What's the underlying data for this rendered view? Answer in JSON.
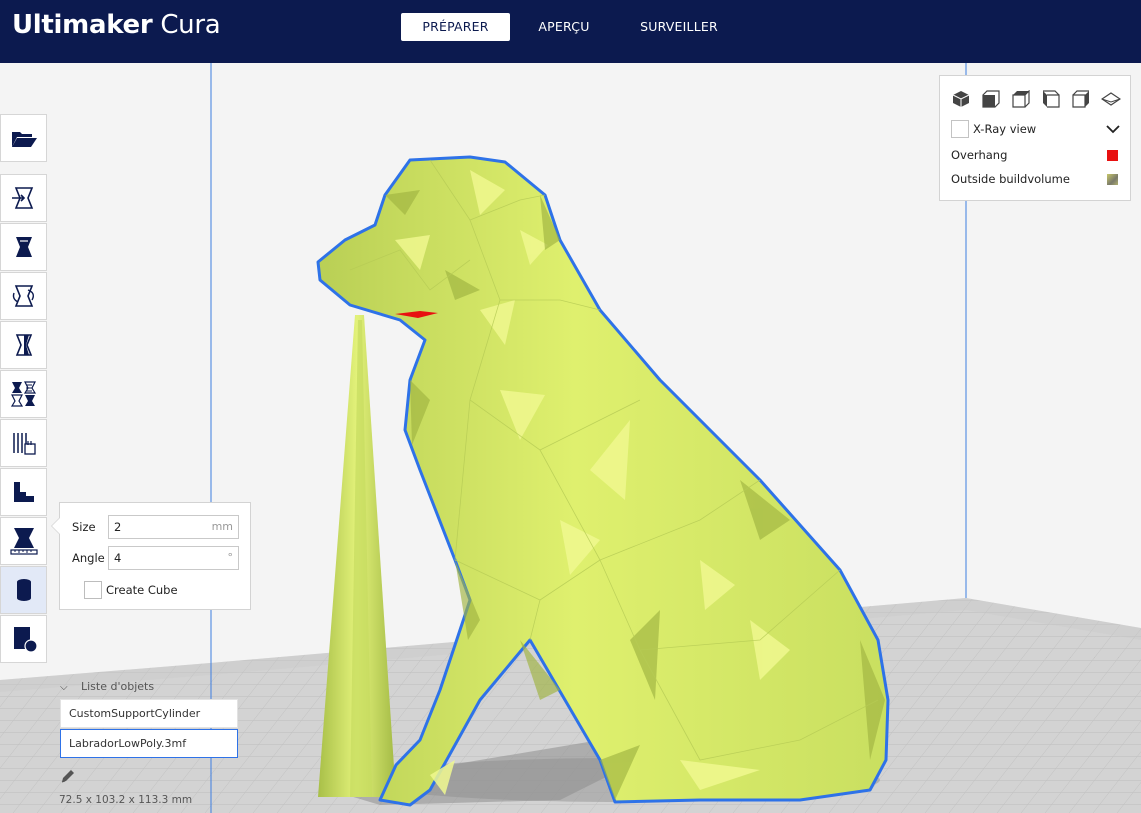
{
  "header": {
    "brand_bold": "Ultimaker",
    "brand_light": " Cura",
    "tabs": [
      {
        "label": "PRÉPARER",
        "active": true
      },
      {
        "label": "APERÇU",
        "active": false
      },
      {
        "label": "SURVEILLER",
        "active": false
      }
    ]
  },
  "toolbar": {
    "tools": [
      {
        "name": "open-file-icon"
      },
      {
        "name": "move-tool-icon"
      },
      {
        "name": "scale-tool-icon"
      },
      {
        "name": "rotate-tool-icon"
      },
      {
        "name": "mirror-tool-icon"
      },
      {
        "name": "per-model-settings-icon"
      },
      {
        "name": "support-blocker-icon"
      },
      {
        "name": "layer-step-icon"
      },
      {
        "name": "measure-icon"
      },
      {
        "name": "support-cylinder-icon",
        "active": true
      },
      {
        "name": "support-cube-icon"
      }
    ]
  },
  "support_panel": {
    "size_label": "Size",
    "size_value": "2",
    "size_unit": "mm",
    "angle_label": "Angle",
    "angle_value": "4",
    "angle_unit": "°",
    "create_cube_label": "Create Cube",
    "create_cube_checked": false
  },
  "view_panel": {
    "camera_icons": [
      "3d-view-icon",
      "front-view-icon",
      "top-view-icon",
      "left-view-icon",
      "right-view-icon",
      "perspective-toggle-icon"
    ],
    "xray_label": "X-Ray view",
    "xray_checked": false,
    "overhang_label": "Overhang",
    "overhang_color": "#e81010",
    "outside_label": "Outside buildvolume",
    "outside_color": "#9a9a6a"
  },
  "object_list": {
    "header": "Liste d'objets",
    "items": [
      {
        "label": "CustomSupportCylinder",
        "selected": false
      },
      {
        "label": "LabradorLowPoly.3mf",
        "selected": true
      }
    ],
    "dimensions": "72.5 x 103.2 x 113.3 mm"
  },
  "colors": {
    "header_bg": "#0c1a4f",
    "model_green": "#d7ec6a",
    "selection_outline": "#2e72e8"
  }
}
